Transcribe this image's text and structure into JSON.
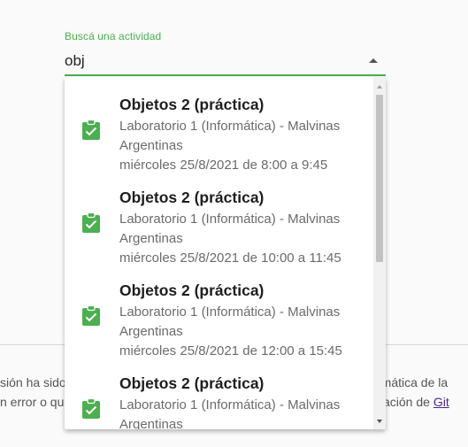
{
  "background": {
    "left_line_1": "sión ha sido",
    "left_line_2": "n error o qu",
    "right_line_1": "rmática de la",
    "right_line_2_prefix": "zación de ",
    "right_line_2_link": "Git"
  },
  "search": {
    "label": "Buscá una actividad",
    "value": "obj",
    "accent_color": "#4caf50"
  },
  "dropdown": {
    "icon": "clipboard-check-icon",
    "options": [
      {
        "title": "Objetos 2 (práctica)",
        "line1": "Laboratorio 1 (Informática) - Malvinas",
        "line2": "Argentinas",
        "line3": "miércoles 25/8/2021 de 8:00 a 9:45"
      },
      {
        "title": "Objetos 2 (práctica)",
        "line1": "Laboratorio 1 (Informática) - Malvinas",
        "line2": "Argentinas",
        "line3": "miércoles 25/8/2021 de 10:00 a 11:45"
      },
      {
        "title": "Objetos 2 (práctica)",
        "line1": "Laboratorio 1 (Informática) - Malvinas",
        "line2": "Argentinas",
        "line3": "miércoles 25/8/2021 de 12:00 a 15:45"
      },
      {
        "title": "Objetos 2 (práctica)",
        "line1": "Laboratorio 1 (Informática) - Malvinas",
        "line2": "Argentinas",
        "line3": ""
      }
    ]
  }
}
